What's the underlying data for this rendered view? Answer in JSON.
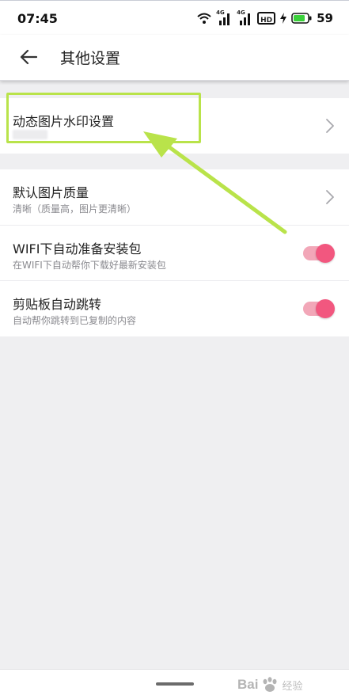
{
  "status_bar": {
    "time": "07:45",
    "signal_label_1": "4G",
    "signal_label_2": "4G",
    "hd_label": "HD",
    "battery": "59",
    "battery_color": "#3ad13a"
  },
  "header": {
    "title": "其他设置"
  },
  "settings": {
    "watermark": {
      "title": "动态图片水印设置"
    },
    "image_quality": {
      "title": "默认图片质量",
      "subtitle": "清晰（质量高，图片更清晰）"
    },
    "wifi_download": {
      "title": "WIFI下自动准备安装包",
      "subtitle": "在WIFI下自动帮你下载好最新安装包",
      "enabled": true
    },
    "clipboard_jump": {
      "title": "剪贴板自动跳转",
      "subtitle": "自动帮你跳转到已复制的内容",
      "enabled": true
    }
  },
  "annotation": {
    "highlight_color": "#b9e34a"
  },
  "watermark_overlay": {
    "brand": "Bai",
    "brand_icon": "paw-icon",
    "sub": "经验"
  },
  "colors": {
    "toggle_on": "#f2577f",
    "toggle_track": "#f2a7b8"
  }
}
